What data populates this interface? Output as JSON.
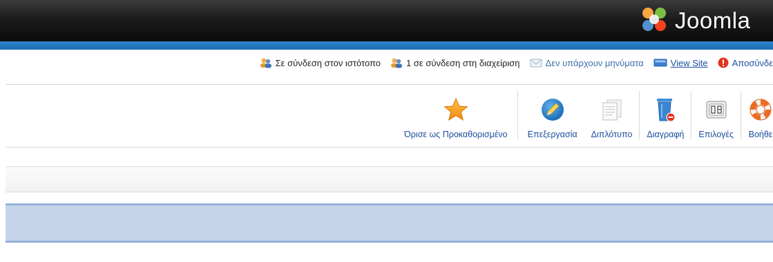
{
  "header": {
    "logo_text": "Joomla",
    "logo_icon": "joomla-logo-icon"
  },
  "status": {
    "users_frontend": "Σε σύνδεση στον ιστότοπο",
    "users_backend": "1 σε σύνδεση στη διαχείριση",
    "messages": "Δεν υπάρχουν μηνύματα",
    "view_site": "View Site",
    "logout": "Αποσύνδε"
  },
  "toolbar": {
    "set_default": "Όρισε ως Προκαθορισμένο",
    "edit": "Επεξεργασία",
    "duplicate": "Διπλότυπο",
    "delete": "Διαγραφή",
    "options": "Επιλογές",
    "help": "Βοήθε"
  },
  "icons": {
    "set_default": "star-icon",
    "edit": "edit-pencil-icon",
    "duplicate": "copy-document-icon",
    "delete": "trash-icon",
    "options": "options-toggle-icon",
    "help": "lifebuoy-icon"
  },
  "colors": {
    "header_dark": "#0b0b0b",
    "header_blue": "#1a6cb6",
    "link_blue": "#1a4e9d",
    "notice_bg": "#c5d4e8"
  }
}
